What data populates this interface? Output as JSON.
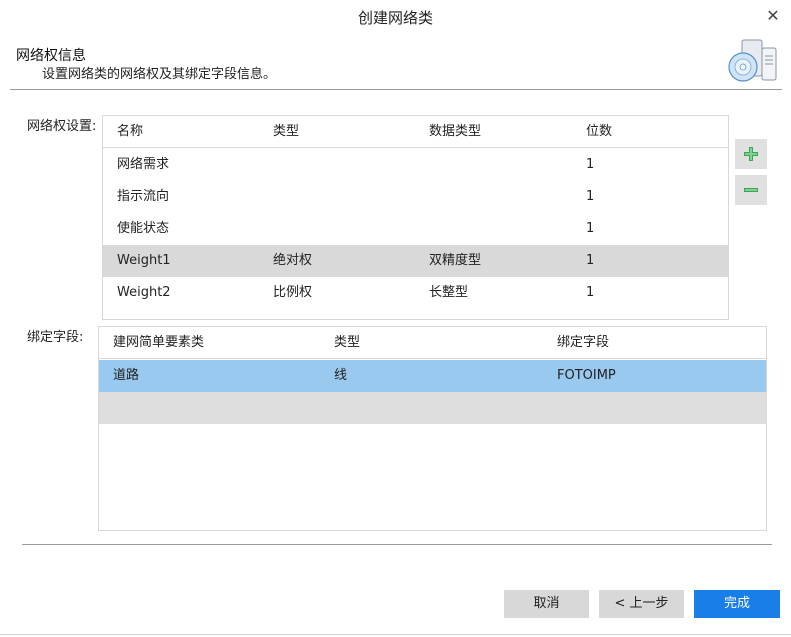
{
  "window": {
    "title": "创建网络类"
  },
  "header": {
    "title": "网络权信息",
    "subtitle": "设置网络类的网络权及其绑定字段信息。"
  },
  "weights": {
    "label": "网络权设置:",
    "columns": [
      "名称",
      "类型",
      "数据类型",
      "位数"
    ],
    "rows": [
      [
        "网络需求",
        "",
        "",
        "1"
      ],
      [
        "指示流向",
        "",
        "",
        "1"
      ],
      [
        "使能状态",
        "",
        "",
        "1"
      ],
      [
        "Weight1",
        "绝对权",
        "双精度型",
        "1"
      ],
      [
        "Weight2",
        "比例权",
        "长整型",
        "1"
      ]
    ],
    "selected_row": 3,
    "add_icon": "plus-icon",
    "remove_icon": "minus-icon"
  },
  "bindings": {
    "label": "绑定字段:",
    "columns": [
      "建网简单要素类",
      "类型",
      "绑定字段"
    ],
    "rows": [
      [
        "道路",
        "线",
        "FOTOIMP"
      ],
      [
        "",
        "",
        ""
      ]
    ],
    "selected_row": 0
  },
  "footer": {
    "cancel_label": "取消",
    "back_label": "< 上一步",
    "finish_label": "完成"
  },
  "colors": {
    "accent": "#1a7ee8",
    "selected_gray": "#d9d9d9",
    "selected_blue": "#99c9ef",
    "add_green": "#3aa655"
  }
}
